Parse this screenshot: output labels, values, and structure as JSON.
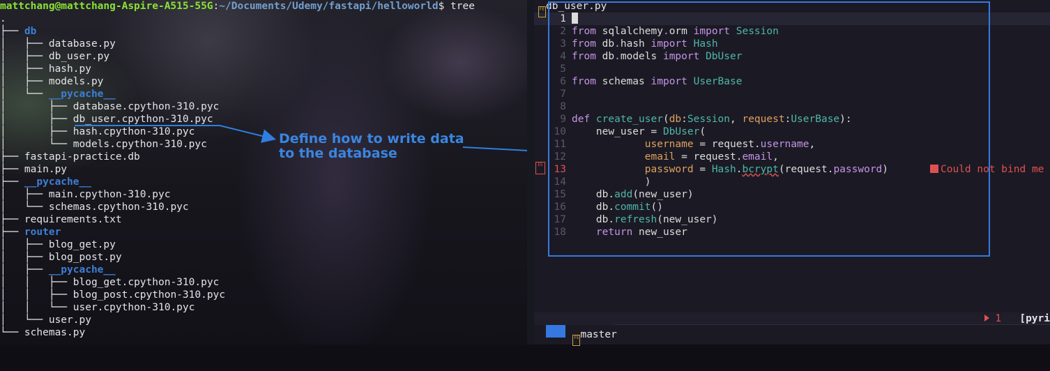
{
  "terminal": {
    "prompt_user": "mattchang@mattchang-Aspire-A515-55G",
    "prompt_sep": ":",
    "prompt_path": "~/Documents/Udemy/fastapi/helloworld",
    "prompt_end": "$ tree",
    "tree_lines": [
      {
        "prefix": ".",
        "name": "",
        "dir": false
      },
      {
        "prefix": "├── ",
        "name": "db",
        "dir": true
      },
      {
        "prefix": "│   ├── ",
        "name": "database.py",
        "dir": false
      },
      {
        "prefix": "│   ├── ",
        "name": "db_user.py",
        "dir": false
      },
      {
        "prefix": "│   ├── ",
        "name": "hash.py",
        "dir": false
      },
      {
        "prefix": "│   ├── ",
        "name": "models.py",
        "dir": false
      },
      {
        "prefix": "│   └── ",
        "name": "__pycache__",
        "dir": true
      },
      {
        "prefix": "│       ├── ",
        "name": "database.cpython-310.pyc",
        "dir": false
      },
      {
        "prefix": "│       ├── ",
        "name": "db_user.cpython-310.pyc",
        "dir": false
      },
      {
        "prefix": "│       ├── ",
        "name": "hash.cpython-310.pyc",
        "dir": false
      },
      {
        "prefix": "│       └── ",
        "name": "models.cpython-310.pyc",
        "dir": false
      },
      {
        "prefix": "├── ",
        "name": "fastapi-practice.db",
        "dir": false
      },
      {
        "prefix": "├── ",
        "name": "main.py",
        "dir": false
      },
      {
        "prefix": "├── ",
        "name": "__pycache__",
        "dir": true
      },
      {
        "prefix": "│   ├── ",
        "name": "main.cpython-310.pyc",
        "dir": false
      },
      {
        "prefix": "│   └── ",
        "name": "schemas.cpython-310.pyc",
        "dir": false
      },
      {
        "prefix": "├── ",
        "name": "requirements.txt",
        "dir": false
      },
      {
        "prefix": "├── ",
        "name": "router",
        "dir": true
      },
      {
        "prefix": "│   ├── ",
        "name": "blog_get.py",
        "dir": false
      },
      {
        "prefix": "│   ├── ",
        "name": "blog_post.py",
        "dir": false
      },
      {
        "prefix": "│   ├── ",
        "name": "__pycache__",
        "dir": true
      },
      {
        "prefix": "│   │   ├── ",
        "name": "blog_get.cpython-310.pyc",
        "dir": false
      },
      {
        "prefix": "│   │   ├── ",
        "name": "blog_post.cpython-310.pyc",
        "dir": false
      },
      {
        "prefix": "│   │   └── ",
        "name": "user.cpython-310.pyc",
        "dir": false
      },
      {
        "prefix": "│   └── ",
        "name": "user.py",
        "dir": false
      },
      {
        "prefix": "└── ",
        "name": "schemas.py",
        "dir": false
      }
    ]
  },
  "annotation": {
    "text": "Define how to write data\nto the database",
    "color": "#3a86e0"
  },
  "editor": {
    "filename": "db_user.py",
    "file_badge": "FE",
    "sign_badge": "E5",
    "lines": [
      {
        "num": "1",
        "tokens": []
      },
      {
        "num": "2",
        "tokens": [
          [
            "kw",
            "from "
          ],
          [
            "plain",
            "sqlalchemy"
          ],
          [
            "kw",
            "."
          ],
          [
            "plain",
            "orm "
          ],
          [
            "kw",
            "import "
          ],
          [
            "type",
            "Session"
          ]
        ]
      },
      {
        "num": "3",
        "tokens": [
          [
            "kw",
            "from "
          ],
          [
            "plain",
            "db"
          ],
          [
            "kw",
            "."
          ],
          [
            "plain",
            "hash "
          ],
          [
            "kw",
            "import "
          ],
          [
            "type",
            "Hash"
          ]
        ]
      },
      {
        "num": "4",
        "tokens": [
          [
            "kw",
            "from "
          ],
          [
            "plain",
            "db"
          ],
          [
            "kw",
            "."
          ],
          [
            "plain",
            "models "
          ],
          [
            "kw",
            "import "
          ],
          [
            "type",
            "DbUser"
          ]
        ]
      },
      {
        "num": "5",
        "tokens": []
      },
      {
        "num": "6",
        "tokens": [
          [
            "kw",
            "from "
          ],
          [
            "plain",
            "schemas "
          ],
          [
            "kw",
            "import "
          ],
          [
            "type",
            "UserBase"
          ]
        ]
      },
      {
        "num": "7",
        "tokens": []
      },
      {
        "num": "8",
        "tokens": []
      },
      {
        "num": "9",
        "tokens": [
          [
            "kw",
            "def "
          ],
          [
            "type",
            "create_user"
          ],
          [
            "plain",
            "("
          ],
          [
            "attr",
            "db"
          ],
          [
            "plain",
            ":"
          ],
          [
            "type",
            "Session"
          ],
          [
            "plain",
            ", "
          ],
          [
            "attr",
            "request"
          ],
          [
            "plain",
            ":"
          ],
          [
            "type",
            "UserBase"
          ],
          [
            "plain",
            "):"
          ]
        ]
      },
      {
        "num": "10",
        "tokens": [
          [
            "plain",
            "    new_user = "
          ],
          [
            "type",
            "DbUser"
          ],
          [
            "plain",
            "("
          ]
        ]
      },
      {
        "num": "11",
        "tokens": [
          [
            "plain",
            "            "
          ],
          [
            "attr",
            "username"
          ],
          [
            "plain",
            " = request."
          ],
          [
            "field",
            "username"
          ],
          [
            "plain",
            ","
          ]
        ]
      },
      {
        "num": "12",
        "tokens": [
          [
            "plain",
            "            "
          ],
          [
            "attr",
            "email"
          ],
          [
            "plain",
            " = request."
          ],
          [
            "field",
            "email"
          ],
          [
            "plain",
            ","
          ]
        ]
      },
      {
        "num": "13",
        "tokens": [
          [
            "plain",
            "            "
          ],
          [
            "attr",
            "password"
          ],
          [
            "plain",
            " = "
          ],
          [
            "type",
            "Hash"
          ],
          [
            "plain",
            "."
          ],
          [
            "squig",
            "bcrypt"
          ],
          [
            "plain",
            "(request."
          ],
          [
            "field",
            "password"
          ],
          [
            "plain",
            ")"
          ]
        ]
      },
      {
        "num": "14",
        "tokens": [
          [
            "plain",
            "            )"
          ]
        ]
      },
      {
        "num": "15",
        "tokens": [
          [
            "plain",
            "    db."
          ],
          [
            "type",
            "add"
          ],
          [
            "plain",
            "(new_user)"
          ]
        ]
      },
      {
        "num": "16",
        "tokens": [
          [
            "plain",
            "    db."
          ],
          [
            "type",
            "commit"
          ],
          [
            "plain",
            "()"
          ]
        ]
      },
      {
        "num": "17",
        "tokens": [
          [
            "plain",
            "    db."
          ],
          [
            "type",
            "refresh"
          ],
          [
            "plain",
            "(new_user)"
          ]
        ]
      },
      {
        "num": "18",
        "tokens": [
          [
            "kw",
            "    return "
          ],
          [
            "plain",
            "new_user"
          ]
        ]
      }
    ],
    "error_message": "Could not bind me",
    "error_line": "13"
  },
  "statusbar": {
    "branch": "master",
    "branch_badge": "FE",
    "error_count": "1",
    "right_label": "[pyri"
  }
}
